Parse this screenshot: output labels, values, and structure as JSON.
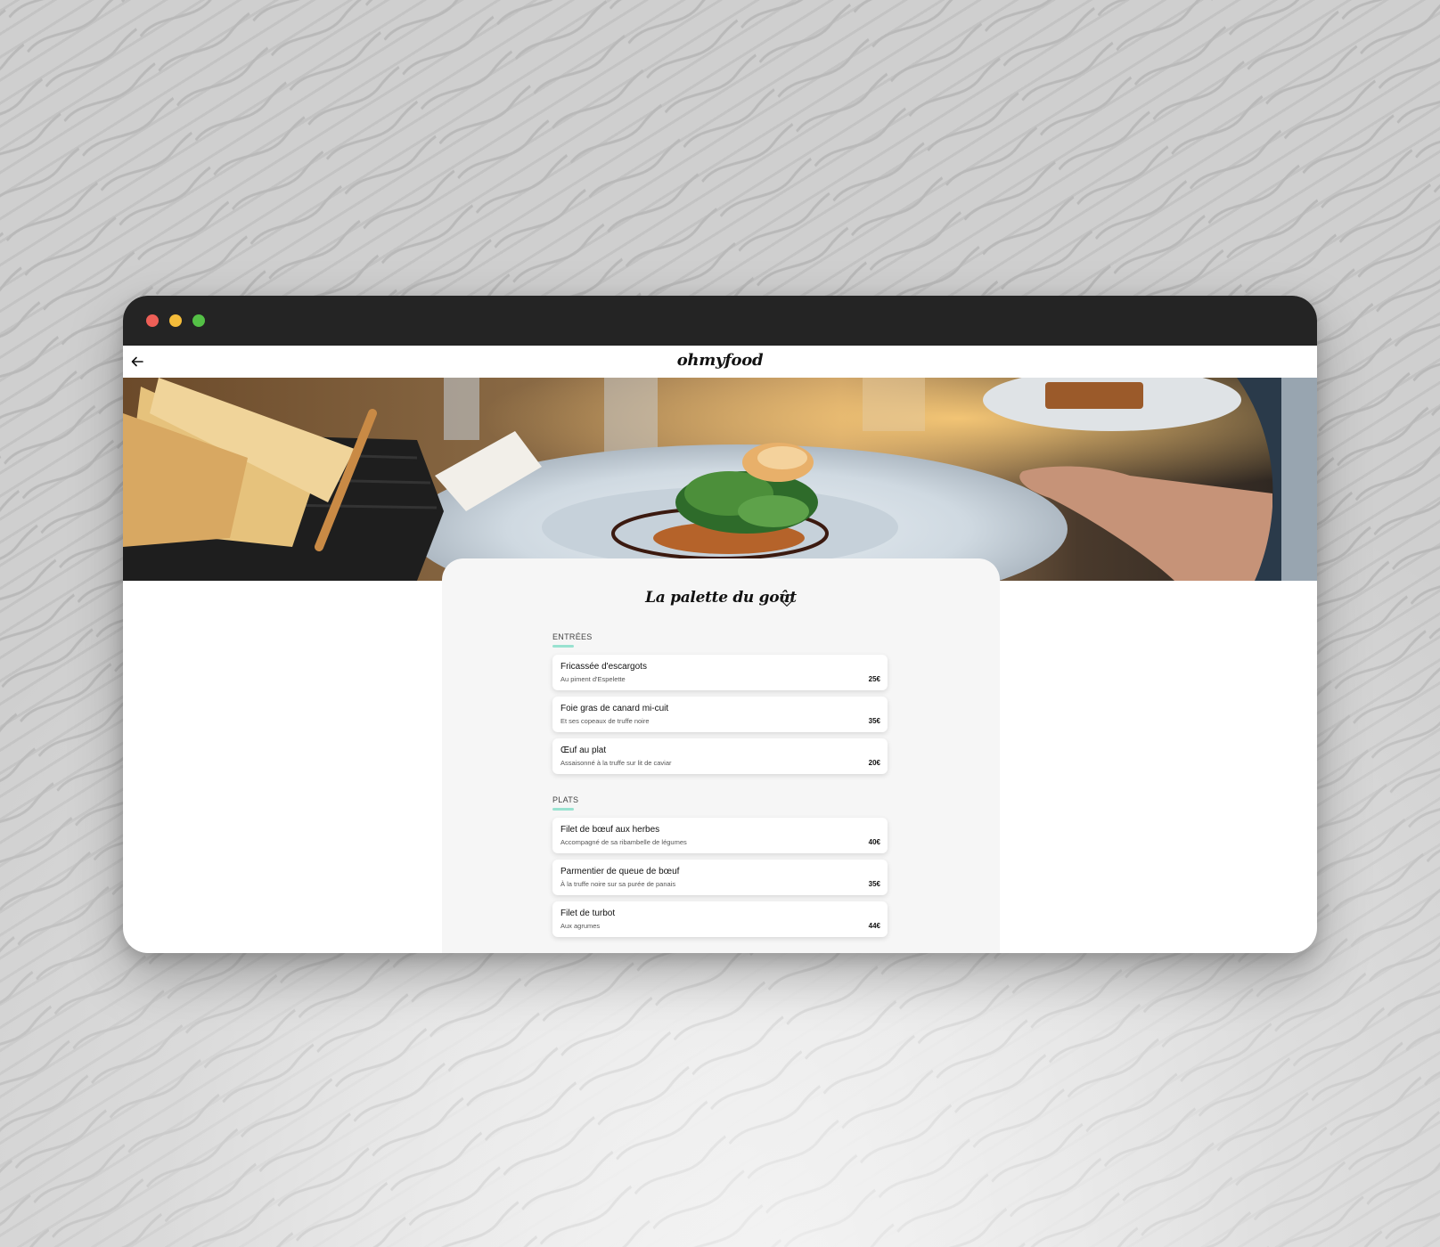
{
  "app": {
    "brand": "ohmyfood"
  },
  "restaurant": {
    "name": "La palette du goût"
  },
  "sections": [
    {
      "label": "ENTRÉES",
      "dishes": [
        {
          "name": "Fricassée d'escargots",
          "description": "Au piment d'Espelette",
          "price": "25€"
        },
        {
          "name": "Foie gras de canard mi-cuit",
          "description": "Et ses copeaux de truffe noire",
          "price": "35€"
        },
        {
          "name": "Œuf au plat",
          "description": "Assaisonné à la truffe sur lit de caviar",
          "price": "20€"
        }
      ]
    },
    {
      "label": "PLATS",
      "dishes": [
        {
          "name": "Filet de bœuf aux herbes",
          "description": "Accompagné de sa ribambelle de légumes",
          "price": "40€"
        },
        {
          "name": "Parmentier de queue de bœuf",
          "description": "À la truffe noire sur sa purée de panais",
          "price": "35€"
        },
        {
          "name": "Filet de turbot",
          "description": "Aux agrumes",
          "price": "44€"
        }
      ]
    }
  ],
  "icons": {
    "back": "back-arrow-icon",
    "favorite": "heart-icon"
  },
  "colors": {
    "titlebar": "#242424",
    "accent": "#99e2d0",
    "card": "#f6f6f6",
    "close": "#ee5f57",
    "minimize": "#f4bc3a",
    "zoom": "#54c046"
  }
}
